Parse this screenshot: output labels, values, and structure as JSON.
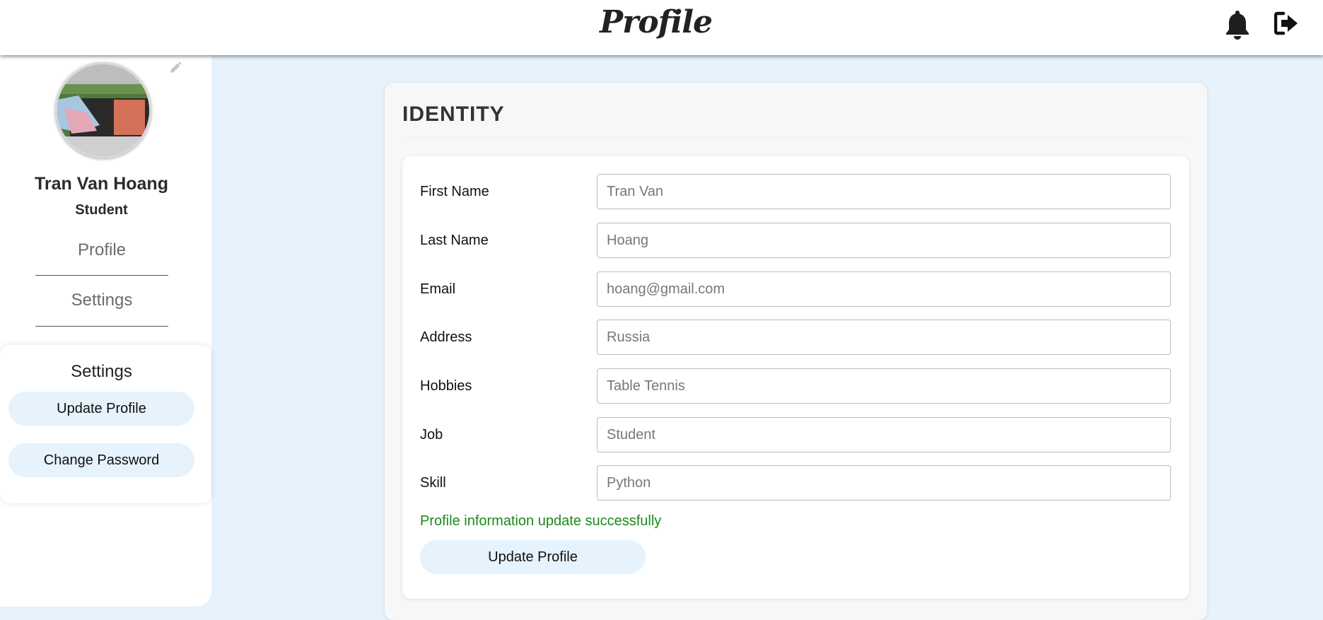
{
  "header": {
    "title": "Profile",
    "icons": [
      "bell-icon",
      "logout-icon"
    ]
  },
  "sidebar": {
    "edit_icon": "pencil-icon",
    "user_name": "Tran Van Hoang",
    "user_role": "Student",
    "nav": {
      "profile": "Profile",
      "settings": "Settings"
    },
    "settings_panel": {
      "title": "Settings",
      "update_profile": "Update Profile",
      "change_password": "Change Password"
    }
  },
  "main": {
    "section_title": "IDENTITY",
    "fields": [
      {
        "label": "First Name",
        "value": "Tran Van"
      },
      {
        "label": "Last Name",
        "value": "Hoang"
      },
      {
        "label": "Email",
        "value": "hoang@gmail.com"
      },
      {
        "label": "Address",
        "value": "Russia"
      },
      {
        "label": "Hobbies",
        "value": "Table Tennis"
      },
      {
        "label": "Job",
        "value": "Student"
      },
      {
        "label": "Skill",
        "value": "Python"
      }
    ],
    "status_message": "Profile information update successfully",
    "submit_label": "Update Profile"
  },
  "colors": {
    "page_background": "#e6f2fc",
    "pill_background": "#e6f2fc",
    "success_text": "#1a8a1a"
  }
}
